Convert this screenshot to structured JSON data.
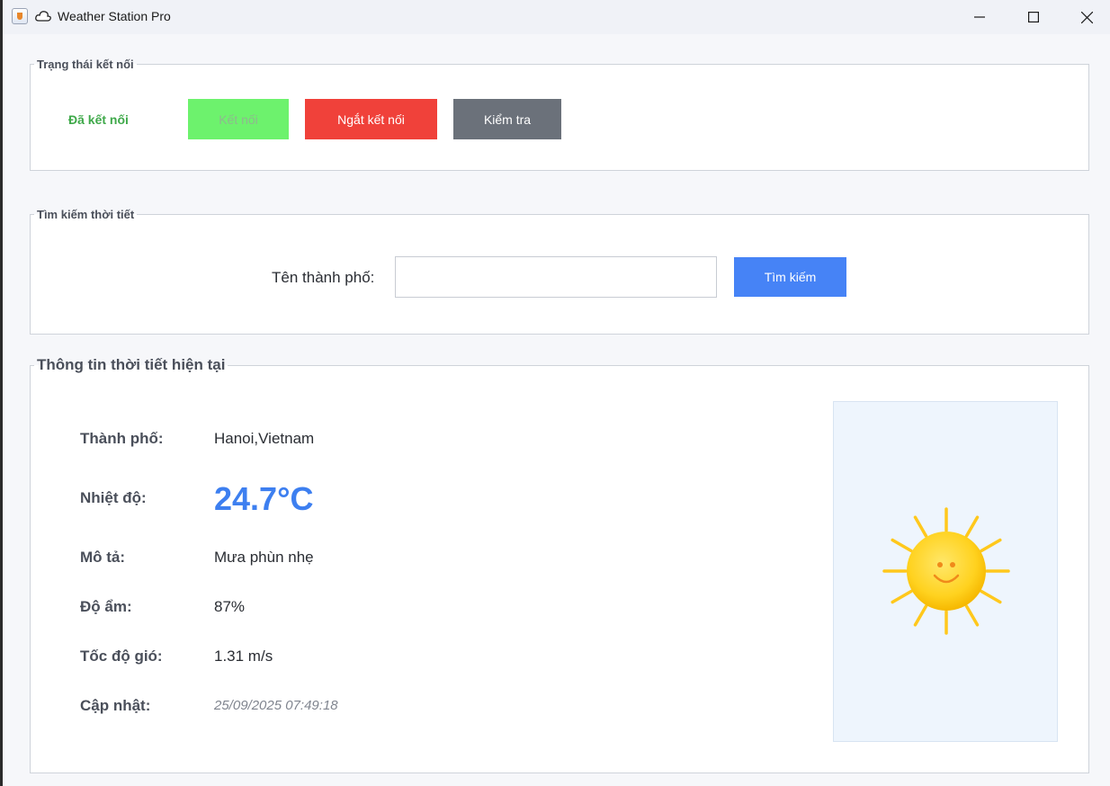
{
  "window": {
    "title": "Weather Station Pro",
    "app_icon": "java-cup-icon",
    "title_icon": "cloud-icon",
    "controls": [
      "minimize-icon",
      "maximize-icon",
      "close-icon"
    ]
  },
  "connection": {
    "legend": "Trạng thái kết nối",
    "status": " Đã kết nối",
    "status_color": "#3fa94a",
    "connect_label": " Kết nối",
    "disconnect_label": " Ngắt kết nối",
    "check_label": " Kiểm tra",
    "colors": {
      "connect": "#6df26d",
      "disconnect": "#f0413a",
      "check": "#6b717a"
    }
  },
  "search": {
    "legend": "Tìm kiếm thời tiết",
    "city_label": "Tên thành phố:",
    "city_value": "",
    "search_label": " Tìm kiếm",
    "search_color": "#4683f6"
  },
  "weather": {
    "legend": " Thông tin thời tiết hiện tại",
    "city_label": " Thành phố:",
    "city_value": "Hanoi,Vietnam",
    "temp_label": " Nhiệt độ:",
    "temp_value": "24.7°C",
    "desc_label": " Mô tả:",
    "desc_value": "Mưa phùn nhẹ",
    "humidity_label": " Độ ẩm:",
    "humidity_value": "87%",
    "wind_label": " Tốc độ gió:",
    "wind_value": "1.31 m/s",
    "updated_label": " Cập nhật:",
    "updated_value": "25/09/2025 07:49:18",
    "weather_icon": "sun-icon",
    "temp_color": "#3d7ff0"
  }
}
